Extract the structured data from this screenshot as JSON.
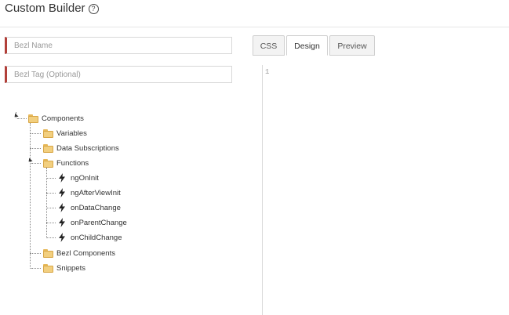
{
  "header": {
    "title": "Custom Builder",
    "help_glyph": "?"
  },
  "form": {
    "name_placeholder": "Bezl Name",
    "tag_placeholder": "Bezl Tag (Optional)"
  },
  "tabs": [
    {
      "label": "CSS",
      "active": false
    },
    {
      "label": "Design",
      "active": true
    },
    {
      "label": "Preview",
      "active": false
    }
  ],
  "editor": {
    "line_number": "1"
  },
  "tree": {
    "root": "Components",
    "children": [
      "Variables",
      "Data Subscriptions",
      "Functions",
      "Bezl Components",
      "Snippets"
    ],
    "functions": [
      "ngOnInit",
      "ngAfterViewInit",
      "onDataChange",
      "onParentChange",
      "onChildChange"
    ]
  },
  "colors": {
    "required_marker": "#b2403a",
    "folder": "#f2cf7f"
  },
  "icons": {
    "folder": "folder-icon",
    "function": "lightning-icon",
    "help": "help-icon"
  }
}
